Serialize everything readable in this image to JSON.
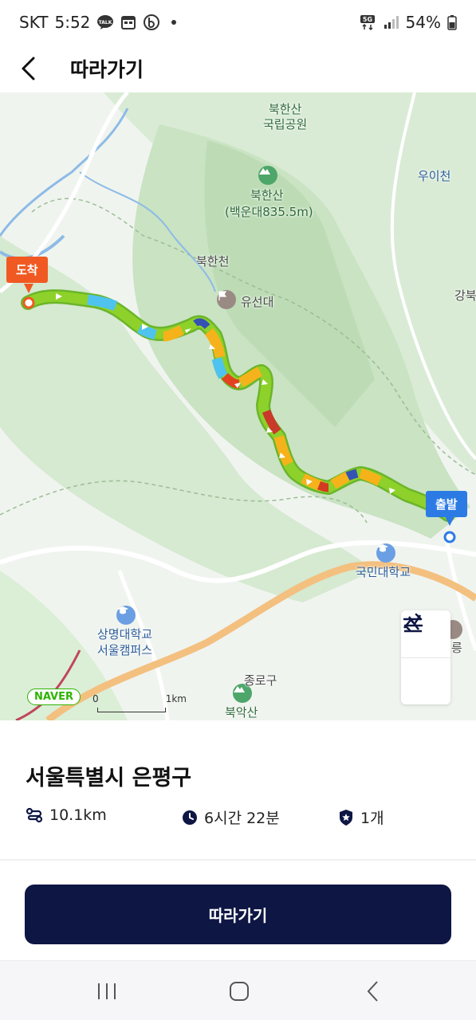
{
  "status": {
    "carrier": "SKT",
    "time": "5:52",
    "network": "5G",
    "battery": "54%"
  },
  "header": {
    "title": "따라가기"
  },
  "map": {
    "labels": {
      "bukhansan_park": "북한산\n국립공원",
      "bukhansan_peak": "북한산",
      "baegundae": "(백운대835.5m)",
      "ui_stream": "우이천",
      "bukhan_stream": "북한천",
      "yuseondae": "유선대",
      "gangbuk": "강북",
      "kookmin_univ": "국민대학교",
      "sangmyung_univ": "상명대학교\n서울캠퍼스",
      "jongno": "종로구",
      "bugaksan": "북악산",
      "road_partial": "릉"
    },
    "flags": {
      "arrive": "도착",
      "start": "출발"
    },
    "attribution": "NAVER",
    "scale": {
      "zero": "0",
      "km": "1km"
    }
  },
  "info": {
    "place_name": "서울특별시 은평구",
    "distance": "10.1km",
    "duration": "6시간 22분",
    "count": "1개"
  },
  "action": {
    "follow_label": "따라가기"
  },
  "colors": {
    "primary_button": "#0e1644",
    "arrive_flag": "#f05a22",
    "start_flag": "#2c7be5",
    "route_green": "#8ed12a"
  }
}
